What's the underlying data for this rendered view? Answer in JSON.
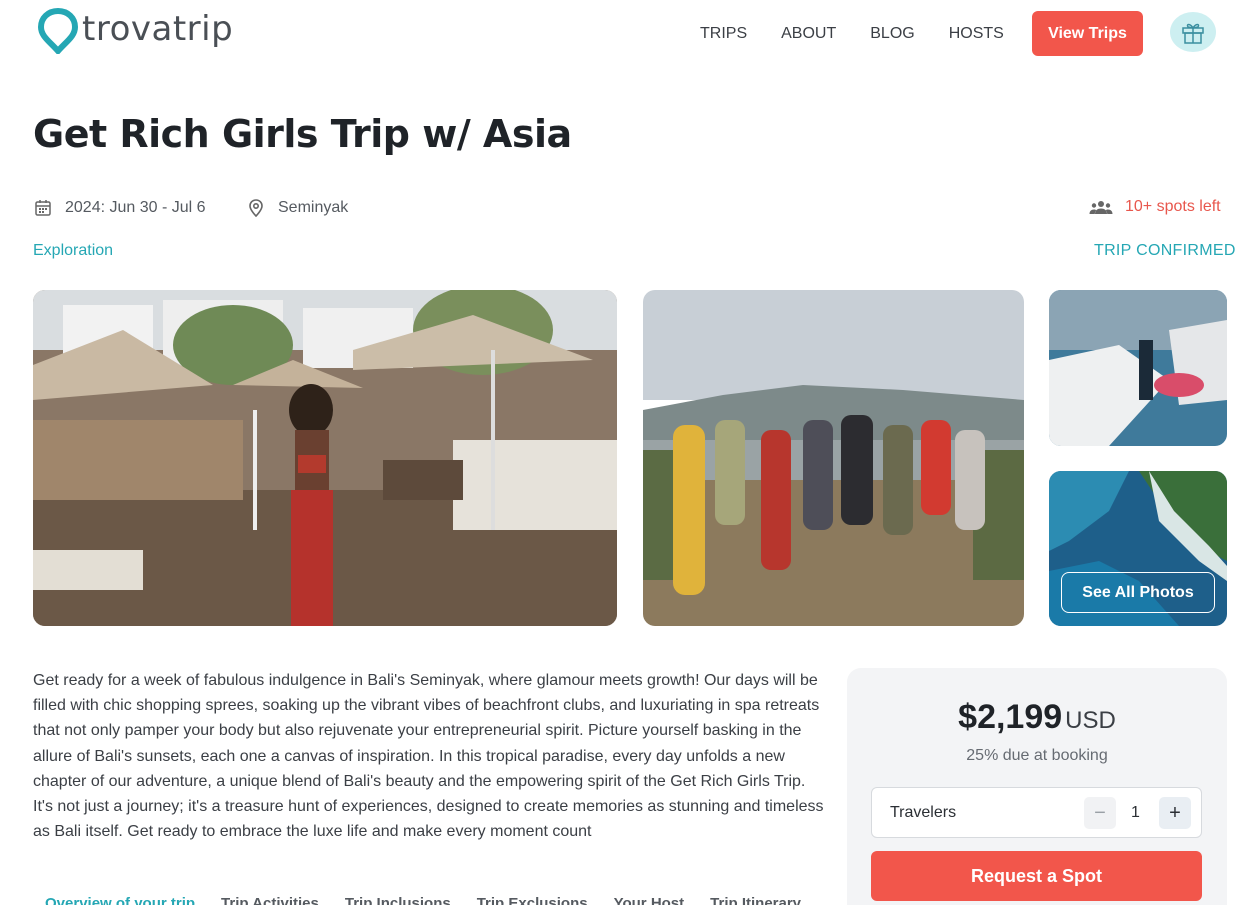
{
  "brand": {
    "name": "trovatrip",
    "accent": "#25a7b4",
    "cta": "#f2564b"
  },
  "nav": {
    "items": [
      "TRIPS",
      "ABOUT",
      "BLOG",
      "HOSTS"
    ],
    "cta_label": "View Trips",
    "gift_icon": "gift-icon"
  },
  "trip": {
    "title": "Get Rich Girls Trip w/ Asia",
    "dates": "2024: Jun 30 - Jul 6",
    "location": "Seminyak",
    "spots": "10+ spots left",
    "category": "Exploration",
    "status": "TRIP CONFIRMED",
    "see_all_label": "See All Photos",
    "description": "Get ready for a week of fabulous indulgence in Bali's Seminyak, where glamour meets growth! Our days will be filled with chic shopping sprees, soaking up the vibrant vibes of beachfront clubs, and luxuriating in spa retreats that not only pamper your body but also rejuvenate your entrepreneurial spirit. Picture yourself basking in the allure of Bali's sunsets, each one a canvas of inspiration. In this tropical paradise, every day unfolds a new chapter of our adventure, a unique blend of Bali's beauty and the empowering spirit of the Get Rich Girls Trip. It's not just a journey; it's a treasure hunt of experiences, designed to create memories as stunning and timeless as Bali itself. Get ready to embrace the luxe life and make every moment count"
  },
  "tabs": [
    "Overview of your trip",
    "Trip Activities",
    "Trip Inclusions",
    "Trip Exclusions",
    "Your Host",
    "Trip Itinerary"
  ],
  "booking": {
    "price": "$2,199",
    "currency": "USD",
    "due": "25% due at booking",
    "travelers_label": "Travelers",
    "travelers_count": "1",
    "minus": "−",
    "plus": "+",
    "request_label": "Request a Spot"
  }
}
